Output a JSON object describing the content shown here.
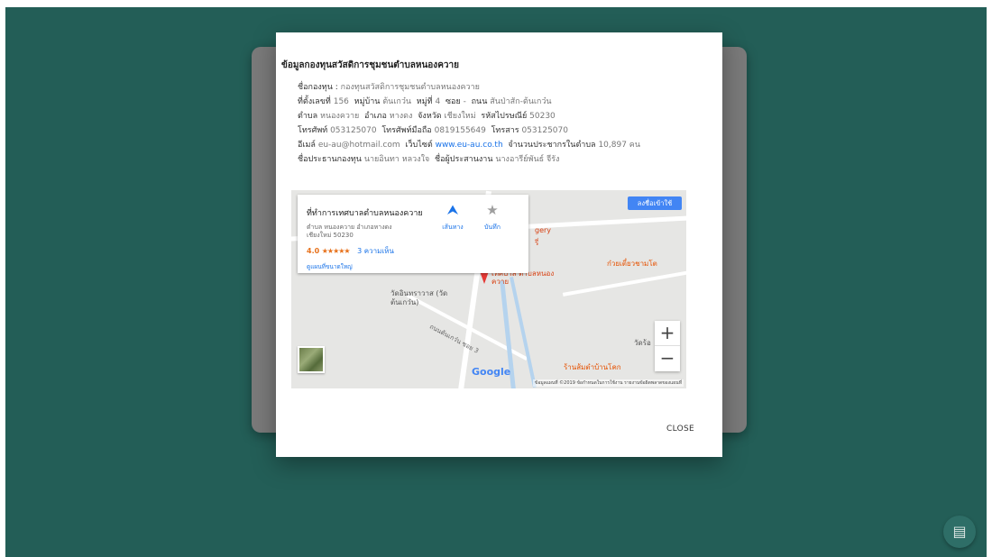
{
  "modal": {
    "title": "ข้อมูลกองทุนสวัสดิการชุมชนตำบลหนองควาย",
    "fund_name_label": "ชื่อกองทุน :",
    "fund_name": "กองทุนสวัสดิการชุมชนตำบลหนองควาย",
    "address_no_label": "ที่ตั้งเลขที่",
    "address_no": "156",
    "village_label": "หมู่บ้าน",
    "village": "ต้นเกว๋น",
    "moo_label": "หมู่ที่",
    "moo": "4",
    "soi_label": "ซอย",
    "soi": "-",
    "road_label": "ถนน",
    "road": "สันป่าสัก-ต้นเกว๋น",
    "tambon_label": "ตำบล",
    "tambon": "หนองควาย",
    "amphoe_label": "อำเภอ",
    "amphoe": "หางดง",
    "province_label": "จังหวัด",
    "province": "เชียงใหม่",
    "postcode_label": "รหัสไปรษณีย์",
    "postcode": "50230",
    "phone_label": "โทรศัพท์",
    "phone": "053125070",
    "mobile_label": "โทรศัพท์มือถือ",
    "mobile": "0819155649",
    "fax_label": "โทรสาร",
    "fax": "053125070",
    "email_label": "อีเมล์",
    "email": "eu-au@hotmail.com",
    "website_label": "เว็บไซต์",
    "website": "www.eu-au.co.th",
    "population_label": "จำนวนประชากรในตำบล",
    "population": "10,897 คน",
    "chairman_label": "ชื่อประธานกองทุน",
    "chairman": "นายอินทา หลวงใจ",
    "coordinator_label": "ชื่อผู้ประสานงาน",
    "coordinator": "นางอารีย์พันธ์ จีรัง",
    "close_label": "CLOSE"
  },
  "map": {
    "place_name": "ที่ทำการเทศบาลตำบลหนองควาย",
    "place_address": "ตำบล หนองควาย อำเภอหางดง เชียงใหม่ 50230",
    "rating": "4.0",
    "stars": "★★★★★",
    "reviews": "3 ความเห็น",
    "bigger_map_link": "ดูแผนที่ขนาดใหญ่",
    "directions_label": "เส้นทาง",
    "save_label": "บันทึก",
    "signin_label": "ลงชื่อเข้าใช้",
    "poi_municipality": "เทศบาล ตำบลหนองควาย",
    "poi_temple": "วัดอินทราวาส (วัดต้นเกว๋น)",
    "poi_noodle": "ก๋วยเตี๋ยวชามโต",
    "poi_shop": "ร้านส้มตำบ้านโคก",
    "poi_road": "ถนนต้นเกว๋น ซอย 3",
    "poi_wat_short": "วัดร้อ",
    "poi_gery": "gery",
    "poi_ri": "รี่",
    "google_logo": "Google",
    "attribution": "ข้อมูลแผนที่ ©2019   ข้อกำหนดในการใช้งาน   รายงานข้อผิดพลาดของแผนที่"
  }
}
